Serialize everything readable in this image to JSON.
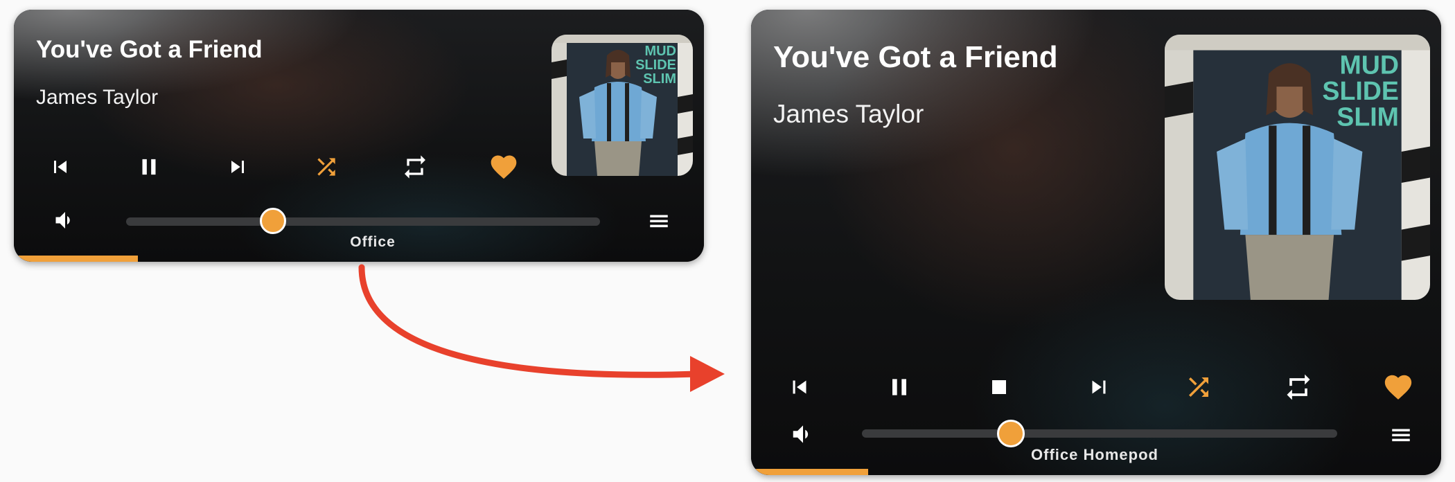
{
  "colors": {
    "accent": "#f0a03a",
    "arrow": "#e8412c",
    "icon": "#ffffff"
  },
  "compact_card": {
    "title": "You've Got a Friend",
    "artist": "James Taylor",
    "album_art_text": "MUD SLIDE SLIM",
    "album_art_label": "James Taylor",
    "controls": [
      "previous-icon",
      "pause-icon",
      "next-icon",
      "shuffle-icon",
      "repeat-icon",
      "heart-icon"
    ],
    "volume_level": 0.31,
    "device": "Office",
    "track_progress": 0.18
  },
  "expanded_card": {
    "title": "You've Got a Friend",
    "artist": "James Taylor",
    "album_art_text": "MUD SLIDE SLIM",
    "album_art_label": "James Taylor",
    "controls": [
      "previous-icon",
      "pause-icon",
      "stop-icon",
      "next-icon",
      "shuffle-icon",
      "repeat-icon",
      "heart-icon"
    ],
    "volume_level": 0.31,
    "device": "Office Homepod",
    "track_progress": 0.17
  }
}
